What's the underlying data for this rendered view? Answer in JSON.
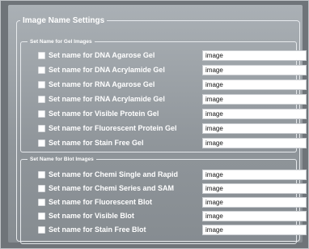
{
  "title": "Image Name Settings",
  "gel_section": {
    "title": "Set Name for Gel Images",
    "rows": [
      {
        "label": "Set name for DNA Agarose Gel",
        "value": "image"
      },
      {
        "label": "Set name for DNA Acrylamide Gel",
        "value": "image"
      },
      {
        "label": "Set name for RNA Agarose Gel",
        "value": "image"
      },
      {
        "label": "Set name for RNA Acrylamide Gel",
        "value": "image"
      },
      {
        "label": "Set name for Visible Protein Gel",
        "value": "image"
      },
      {
        "label": "Set name for Fluorescent Protein Gel",
        "value": "image"
      },
      {
        "label": "Set name for Stain Free Gel",
        "value": "image"
      }
    ]
  },
  "blot_section": {
    "title": "Set Name for Blot Images",
    "rows": [
      {
        "label": "Set name for Chemi Single and Rapid",
        "value": "image"
      },
      {
        "label": "Set name for Chemi Series and SAM",
        "value": "image"
      },
      {
        "label": "Set name for Fluorescent Blot",
        "value": "image"
      },
      {
        "label": "Set name for Visible Blot",
        "value": "image"
      },
      {
        "label": "Set name for Stain Free Blot",
        "value": "image"
      }
    ]
  }
}
